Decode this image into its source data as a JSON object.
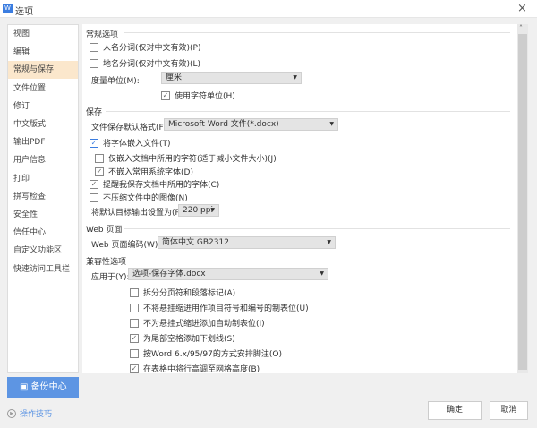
{
  "window": {
    "title": "选项",
    "icon": "wps-writer-icon",
    "close": "×"
  },
  "sidebar": {
    "items": [
      "视图",
      "编辑",
      "常规与保存",
      "文件位置",
      "修订",
      "中文版式",
      "输出PDF",
      "用户信息",
      "打印",
      "拼写检查",
      "安全性",
      "信任中心",
      "自定义功能区",
      "快速访问工具栏"
    ],
    "active": "常规与保存"
  },
  "general": {
    "title": "常规选项",
    "person_split": "人名分词(仅对中文有效)(P)",
    "place_split": "地名分词(仅对中文有效)(L)",
    "unit_label": "度量单位(M):",
    "unit_value": "厘米",
    "use_char_unit": "使用字符单位(H)"
  },
  "save": {
    "title": "保存",
    "format_label": "文件保存默认格式(F):",
    "format_value": "Microsoft Word 文件(*.docx)",
    "embed_fonts": "将字体嵌入文件(T)",
    "embed_used_only": "仅嵌入文档中所用的字符(适于减小文件大小)(J)",
    "no_embed_system": "不嵌入常用系统字体(D)",
    "remind_fonts": "提醒我保存文档中所用的字体(C)",
    "no_compress": "不压缩文件中的图像(N)",
    "ppi_label": "将默认目标输出设置为(P):",
    "ppi_value": "220 ppi"
  },
  "web": {
    "title": "Web 页面",
    "encoding_label": "Web 页面编码(W):",
    "encoding_value": "简体中文 GB2312"
  },
  "compat": {
    "title": "兼容性选项",
    "apply_label": "应用于(Y):",
    "apply_value": "选项-保存字体.docx",
    "options": [
      {
        "label": "拆分分页符和段落标记(A)",
        "checked": false
      },
      {
        "label": "不将悬挂缩进用作项目符号和编号的制表位(U)",
        "checked": false
      },
      {
        "label": "不为悬挂式缩进添加自动制表位(I)",
        "checked": false
      },
      {
        "label": "为尾部空格添加下划线(S)",
        "checked": true
      },
      {
        "label": "按Word 6.x/95/97的方式安排脚注(O)",
        "checked": false
      },
      {
        "label": "在表格中将行高调至网格高度(B)",
        "checked": true
      }
    ]
  },
  "footer": {
    "backup": "备份中心",
    "tips": "操作技巧",
    "ok": "确定",
    "cancel": "取消"
  },
  "checks": {
    "person": false,
    "place": false,
    "char_unit": true,
    "embed": true,
    "embed_used": false,
    "no_system": true,
    "remind": true,
    "no_compress": false
  },
  "colors": {
    "accent": "#5d95e3",
    "active_nav": "#fbe7cc"
  }
}
